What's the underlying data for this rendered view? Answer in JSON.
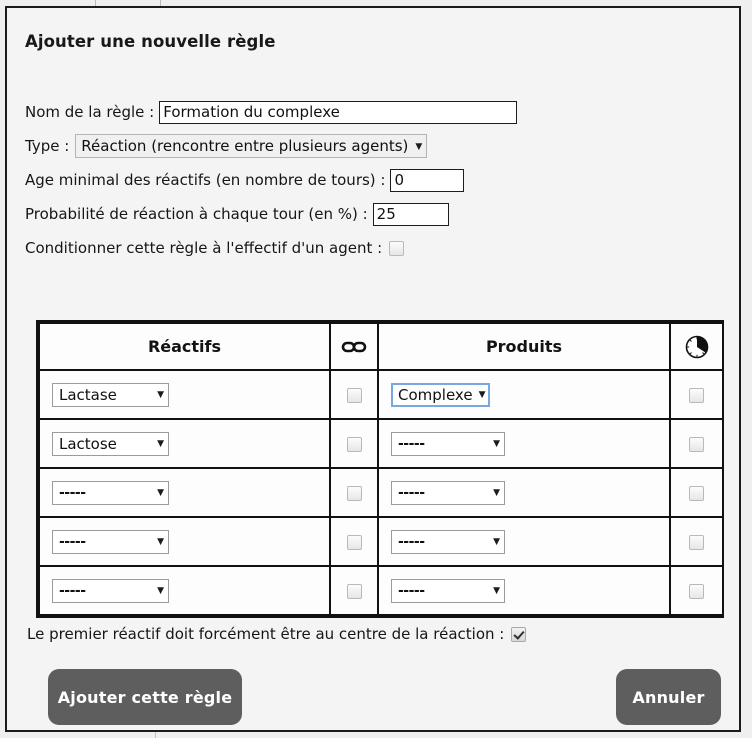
{
  "dialog": {
    "title": "Ajouter une nouvelle règle"
  },
  "form": {
    "rule_name": {
      "label": "Nom de la règle :",
      "value": "Formation du complexe",
      "placeholder": ""
    },
    "type": {
      "label": "Type :",
      "value": "Réaction (rencontre entre plusieurs agents)"
    },
    "min_age": {
      "label": "Age minimal des réactifs (en nombre de tours) :",
      "value": "0"
    },
    "probability": {
      "label": "Probabilité de réaction à chaque tour (en %) :",
      "value": "25"
    },
    "condition_agent": {
      "label": "Conditionner cette règle à l'effectif d'un agent :",
      "checked": false
    }
  },
  "table": {
    "headers": {
      "reactifs": "Réactifs",
      "link_icon": "link-icon",
      "produits": "Produits",
      "clock_icon": "clock-icon"
    },
    "empty_option": "-----",
    "rows": [
      {
        "reactif": "Lactase",
        "reactif_empty": false,
        "link_checked": false,
        "produit": "Complexe",
        "produit_empty": false,
        "produit_focused": true,
        "time_checked": false
      },
      {
        "reactif": "Lactose",
        "reactif_empty": false,
        "link_checked": false,
        "produit": "-----",
        "produit_empty": true,
        "produit_focused": false,
        "time_checked": false
      },
      {
        "reactif": "-----",
        "reactif_empty": true,
        "link_checked": false,
        "produit": "-----",
        "produit_empty": true,
        "produit_focused": false,
        "time_checked": false
      },
      {
        "reactif": "-----",
        "reactif_empty": true,
        "link_checked": false,
        "produit": "-----",
        "produit_empty": true,
        "produit_focused": false,
        "time_checked": false
      },
      {
        "reactif": "-----",
        "reactif_empty": true,
        "link_checked": false,
        "produit": "-----",
        "produit_empty": true,
        "produit_focused": false,
        "time_checked": false
      }
    ]
  },
  "footer": {
    "center_note": {
      "label": "Le premier réactif doit forcément être au centre de la réaction :",
      "checked": true
    },
    "add_button": "Ajouter cette règle",
    "cancel_button": "Annuler"
  },
  "colors": {
    "button_bg": "#5e5e5e",
    "button_text": "#ffffff",
    "panel_bg": "#f4f4f4",
    "panel_border": "#1b1b1b",
    "focus_outline": "#7aa7e0",
    "table_border": "#111111"
  }
}
